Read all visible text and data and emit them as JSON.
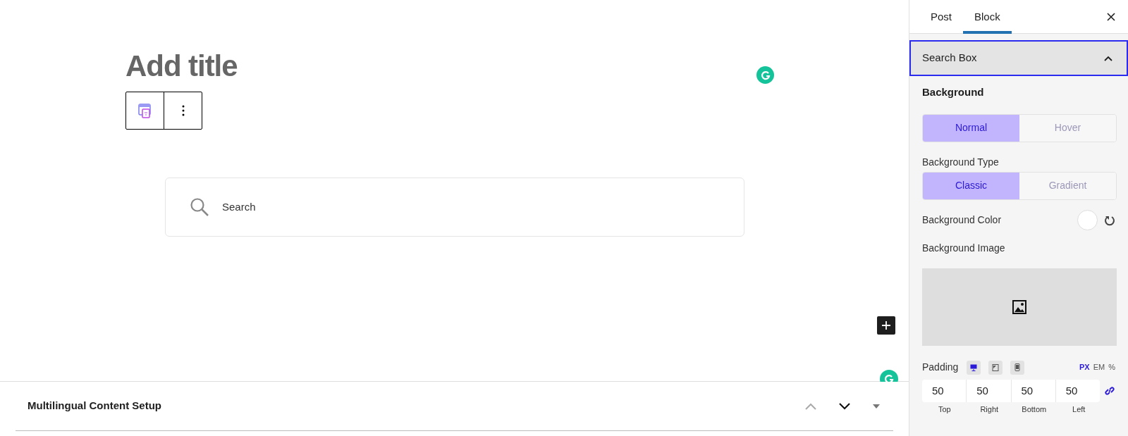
{
  "editor": {
    "title_placeholder": "Add title",
    "search_placeholder": "Search"
  },
  "bottom_panel": {
    "title": "Multilingual Content Setup"
  },
  "sidebar": {
    "tabs": [
      {
        "label": "Post",
        "selected": false
      },
      {
        "label": "Block",
        "selected": true
      }
    ],
    "panel": {
      "title": "Search Box",
      "expanded": true
    },
    "background_heading": "Background",
    "state_toggle": [
      {
        "label": "Normal",
        "selected": true
      },
      {
        "label": "Hover",
        "selected": false
      }
    ],
    "background_type_label": "Background Type",
    "background_type": [
      {
        "label": "Classic",
        "selected": true
      },
      {
        "label": "Gradient",
        "selected": false
      }
    ],
    "background_color_label": "Background Color",
    "background_image_label": "Background Image",
    "padding": {
      "label": "Padding",
      "devices": [
        {
          "kind": "desktop",
          "selected": true
        },
        {
          "kind": "tablet",
          "selected": false
        },
        {
          "kind": "mobile",
          "selected": false
        }
      ],
      "units": [
        {
          "label": "PX",
          "selected": true
        },
        {
          "label": "EM",
          "selected": false
        },
        {
          "label": "%",
          "selected": false
        }
      ],
      "values": [
        {
          "value": "50",
          "label": "Top"
        },
        {
          "value": "50",
          "label": "Right"
        },
        {
          "value": "50",
          "label": "Bottom"
        },
        {
          "value": "50",
          "label": "Left"
        }
      ],
      "linked": true
    }
  }
}
